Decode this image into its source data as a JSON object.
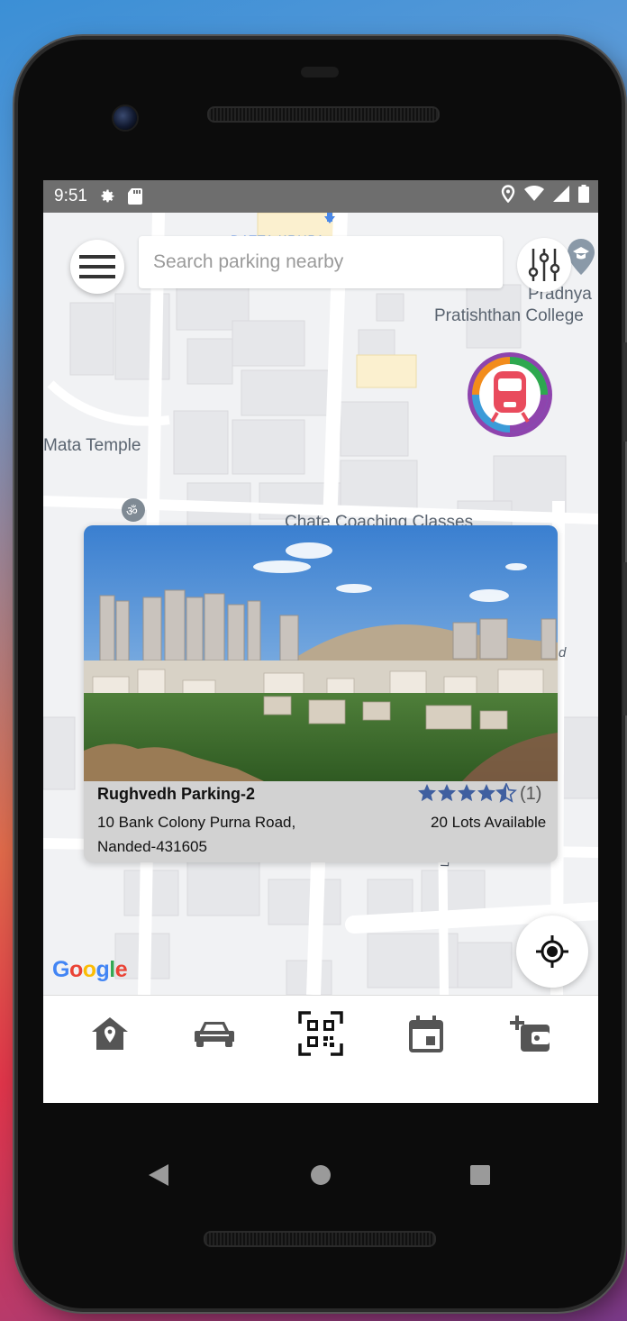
{
  "status_bar": {
    "time": "9:51",
    "left_icons": [
      "gear-icon",
      "sd-card-icon"
    ],
    "right_icons": [
      "location-pin-icon",
      "wifi-icon",
      "signal-icon",
      "battery-icon"
    ]
  },
  "search": {
    "placeholder": "Search parking nearby"
  },
  "map": {
    "labels": {
      "college_line1": "Pradnya",
      "college_line2": "Pratishthan College",
      "temple": "Mata Temple",
      "coaching": "Chate Coaching Classes",
      "lane": "Lane",
      "road_top": "DATTA KRUPA",
      "road_right": "d"
    },
    "google_logo": "Google"
  },
  "parking_card": {
    "name": "Rughvedh Parking-2",
    "address_line1": "10 Bank Colony Purna Road,",
    "address_line2": "Nanded-431605",
    "rating": 4.5,
    "rating_count": "(1)",
    "lots": "20 Lots Available"
  },
  "bottom_nav": {
    "items": [
      "home-pin-icon",
      "car-icon",
      "qr-scan-icon",
      "calendar-icon",
      "add-wallet-icon"
    ]
  },
  "colors": {
    "status_bar": "#6e6e6e",
    "star": "#3f5fa0",
    "nav_icon": "#555555",
    "metro_ring": "#8e44ad"
  }
}
